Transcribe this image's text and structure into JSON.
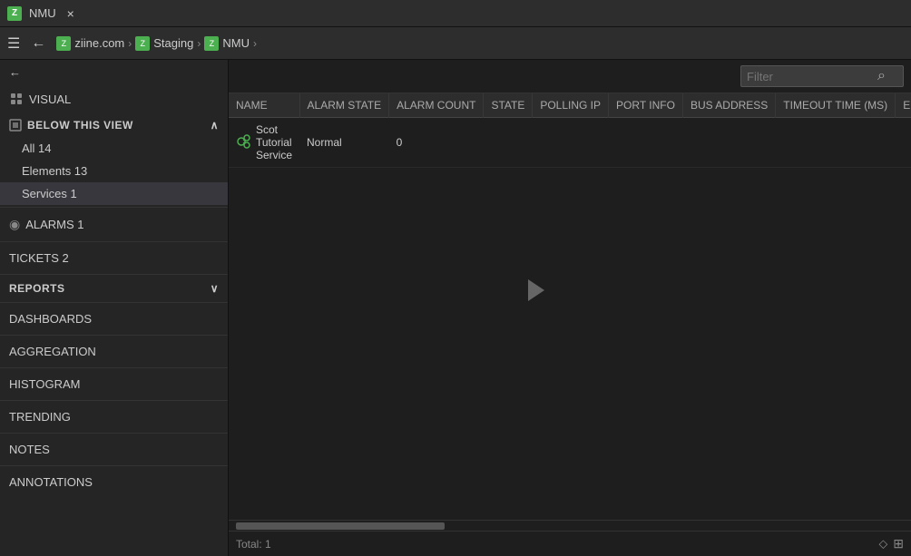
{
  "titlebar": {
    "app_name": "NMU",
    "close_label": "×",
    "icon_text": "Z"
  },
  "breadcrumb": {
    "menu_icon": "☰",
    "back_icon": "←",
    "items": [
      {
        "label": "ziine.com",
        "icon": "Z",
        "chevron": "›"
      },
      {
        "label": "Staging",
        "icon": "Z",
        "chevron": "›"
      },
      {
        "label": "NMU",
        "icon": "Z",
        "chevron": "›"
      }
    ]
  },
  "sidebar": {
    "back_icon": "←",
    "visual_label": "VISUAL",
    "below_this_view_label": "BELOW THIS VIEW",
    "collapse_icon": "∧",
    "items": [
      {
        "id": "all",
        "label": "All 14"
      },
      {
        "id": "elements",
        "label": "Elements 13"
      },
      {
        "id": "services",
        "label": "Services 1",
        "active": true
      }
    ],
    "alarms_label": "ALARMS 1",
    "alarms_icon": "◉",
    "tickets_label": "TICKETS 2",
    "reports_label": "REPORTS",
    "reports_expand": "∨",
    "dashboards_label": "DASHBOARDS",
    "aggregation_label": "AGGREGATION",
    "histogram_label": "HISTOGRAM",
    "trending_label": "TRENDING",
    "notes_label": "NOTES",
    "annotations_label": "ANNOTATIONS"
  },
  "content": {
    "filter_placeholder": "Filter",
    "filter_icon": "⌕",
    "table": {
      "columns": [
        "NAME",
        "ALARM STATE",
        "ALARM COUNT",
        "STATE",
        "POLLING IP",
        "PORT INFO",
        "BUS ADDRESS",
        "TIMEOUT TIME (MS)",
        "EL"
      ],
      "rows": [
        {
          "name": "Scot Tutorial Service",
          "alarm_state": "Normal",
          "alarm_count": "0",
          "state": "",
          "polling_ip": "",
          "port_info": "",
          "bus_address": "",
          "timeout_ms": "",
          "el": ""
        }
      ]
    },
    "total_label": "Total: 1"
  }
}
